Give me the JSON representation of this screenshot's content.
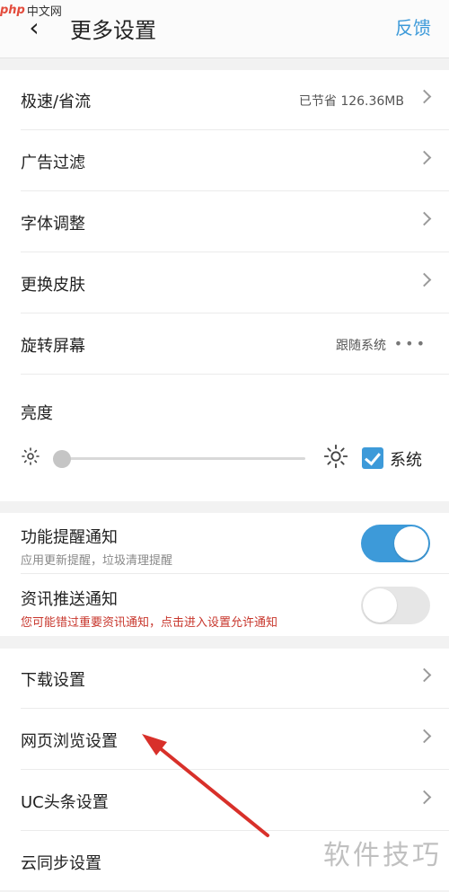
{
  "watermark": {
    "prefix": "php",
    "name": "中文网"
  },
  "header": {
    "title": "更多设置",
    "feedback": "反馈"
  },
  "section1": {
    "rows": [
      {
        "label": "极速/省流",
        "value": "已节省 126.36MB"
      },
      {
        "label": "广告过滤"
      },
      {
        "label": "字体调整"
      },
      {
        "label": "更换皮肤"
      },
      {
        "label": "旋转屏幕",
        "value": "跟随系统",
        "more": "•••"
      }
    ],
    "brightness": {
      "label": "亮度",
      "level": 0.0,
      "system_label": "系统",
      "system_checked": true
    }
  },
  "notifications": [
    {
      "title": "功能提醒通知",
      "subtitle": "应用更新提醒，垃圾清理提醒",
      "enabled": true
    },
    {
      "title": "资讯推送通知",
      "subtitle": "您可能错过重要资讯通知，点击进入设置允许通知",
      "enabled": false
    }
  ],
  "section3": {
    "rows": [
      {
        "label": "下载设置"
      },
      {
        "label": "网页浏览设置"
      },
      {
        "label": "UC头条设置"
      },
      {
        "label": "云同步设置"
      }
    ]
  },
  "watermark_bottom": "软件技巧",
  "colors": {
    "accent": "#3d9ad9",
    "warning": "#c8372d",
    "annotation": "#d8302a"
  }
}
